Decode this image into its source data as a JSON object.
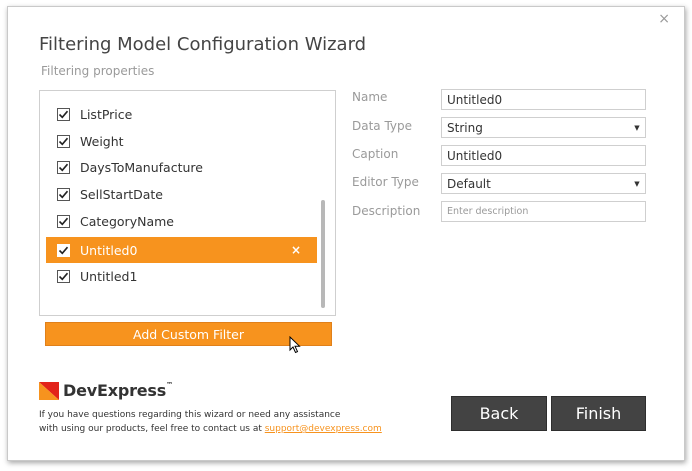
{
  "window": {
    "title": "Filtering Model Configuration Wizard",
    "subtitle": "Filtering properties",
    "close_glyph": "×"
  },
  "properties_list": {
    "items": [
      {
        "label": "ListPrice",
        "checked": true,
        "selected": false
      },
      {
        "label": "Weight",
        "checked": true,
        "selected": false
      },
      {
        "label": "DaysToManufacture",
        "checked": true,
        "selected": false
      },
      {
        "label": "SellStartDate",
        "checked": true,
        "selected": false
      },
      {
        "label": "CategoryName",
        "checked": true,
        "selected": false
      },
      {
        "label": "Untitled0",
        "checked": true,
        "selected": true
      },
      {
        "label": "Untitled1",
        "checked": true,
        "selected": false
      }
    ],
    "remove_glyph": "×"
  },
  "add_custom_filter_label": "Add Custom Filter",
  "property_editor": {
    "name_label": "Name",
    "name_value": "Untitled0",
    "data_type_label": "Data Type",
    "data_type_value": "String",
    "caption_label": "Caption",
    "caption_value": "Untitled0",
    "editor_type_label": "Editor Type",
    "editor_type_value": "Default",
    "description_label": "Description",
    "description_placeholder": "Enter description"
  },
  "footer": {
    "brand": "DevExpress",
    "brand_tm": "™",
    "line1": "If you have questions regarding this wizard or need any assistance",
    "line2_prefix": "with using our products, feel free to contact us at ",
    "support_email": "support@devexpress.com"
  },
  "buttons": {
    "back_label": "Back",
    "finish_label": "Finish"
  },
  "colors": {
    "accent": "#f7931e",
    "dark_button": "#434343",
    "logo_red": "#e2231a"
  }
}
